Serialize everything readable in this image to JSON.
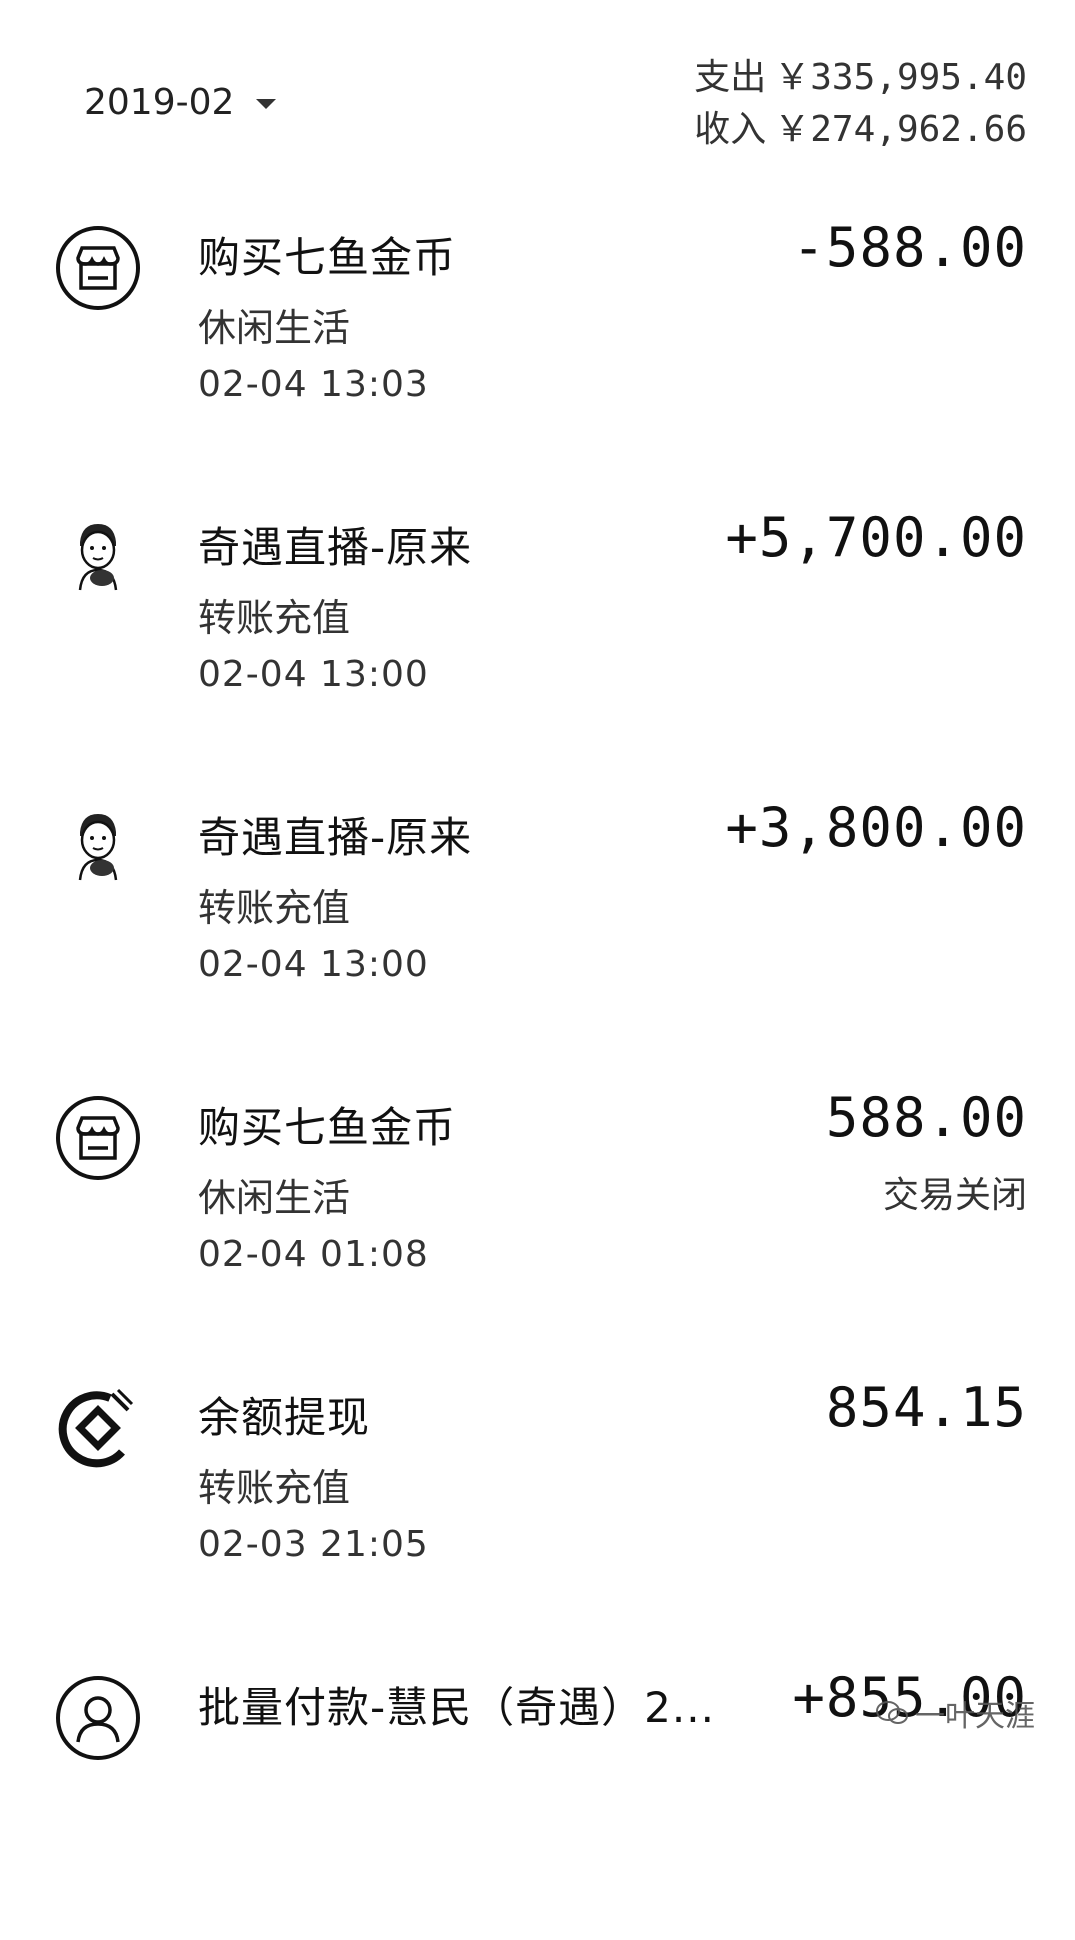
{
  "header": {
    "month": "2019-02",
    "expense_label": "支出",
    "expense_value": "￥335,995.40",
    "income_label": "收入",
    "income_value": "￥274,962.66"
  },
  "transactions": [
    {
      "title": "购买七鱼金币",
      "category": "休闲生活",
      "time": "02-04  13:03",
      "amount": "-588.00",
      "status": "",
      "icon": "store-icon"
    },
    {
      "title": "奇遇直播-原来",
      "category": "转账充值",
      "time": "02-04  13:00",
      "amount": "+5,700.00",
      "status": "",
      "icon": "avatar-cartoon-icon"
    },
    {
      "title": "奇遇直播-原来",
      "category": "转账充值",
      "time": "02-04  13:00",
      "amount": "+3,800.00",
      "status": "",
      "icon": "avatar-cartoon-icon"
    },
    {
      "title": "购买七鱼金币",
      "category": "休闲生活",
      "time": "02-04  01:08",
      "amount": "588.00",
      "status": "交易关闭",
      "icon": "store-icon"
    },
    {
      "title": "余额提现",
      "category": "转账充值",
      "time": "02-03  21:05",
      "amount": "854.15",
      "status": "",
      "icon": "bank-icon"
    },
    {
      "title": "批量付款-慧民（奇遇）2...",
      "category": "",
      "time": "",
      "amount": "+855.00",
      "status": "",
      "icon": "person-icon"
    }
  ],
  "watermark": "一叶天涯"
}
